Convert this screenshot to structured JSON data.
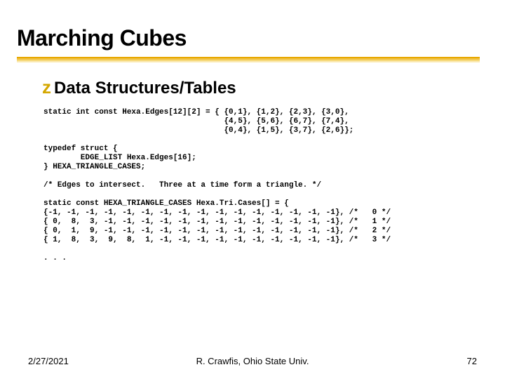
{
  "title": "Marching Cubes",
  "bullet": "Data Structures/Tables",
  "code": "static int const Hexa.Edges[12][2] = { {0,1}, {1,2}, {2,3}, {3,0},\n                                       {4,5}, {5,6}, {6,7}, {7,4},\n                                       {0,4}, {1,5}, {3,7}, {2,6}};\n\ntypedef struct {\n        EDGE_LIST Hexa.Edges[16];\n} HEXA_TRIANGLE_CASES;\n\n/* Edges to intersect.   Three at a time form a triangle. */\n\nstatic const HEXA_TRIANGLE_CASES Hexa.Tri.Cases[] = {\n{-1, -1, -1, -1, -1, -1, -1, -1, -1, -1, -1, -1, -1, -1, -1, -1}, /*   0 */\n{ 0,  8,  3, -1, -1, -1, -1, -1, -1, -1, -1, -1, -1, -1, -1, -1}, /*   1 */\n{ 0,  1,  9, -1, -1, -1, -1, -1, -1, -1, -1, -1, -1, -1, -1, -1}, /*   2 */\n{ 1,  8,  3,  9,  8,  1, -1, -1, -1, -1, -1, -1, -1, -1, -1, -1}, /*   3 */\n\n. . .",
  "footer": {
    "date": "2/27/2021",
    "center": "R. Crawfis, Ohio State Univ.",
    "page": "72"
  }
}
